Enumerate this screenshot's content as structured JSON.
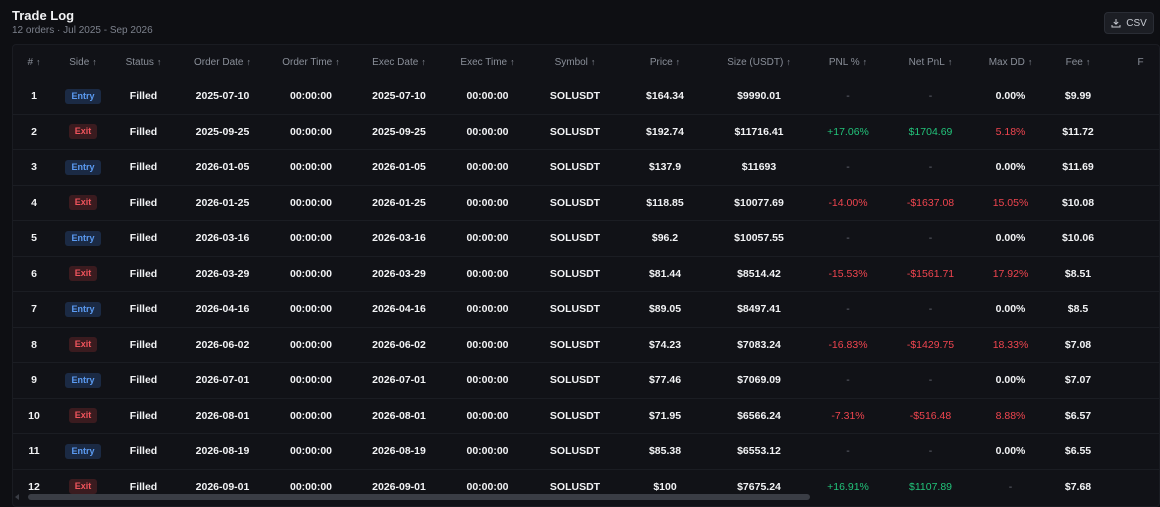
{
  "header": {
    "title": "Trade Log",
    "subtitle": "12 orders · Jul 2025 - Sep 2026",
    "csv_label": "CSV"
  },
  "columns": [
    "#",
    "Side",
    "Status",
    "Order Date",
    "Order Time",
    "Exec Date",
    "Exec Time",
    "Symbol",
    "Price",
    "Size (USDT)",
    "PNL %",
    "Net PnL",
    "Max DD",
    "Fee",
    "F"
  ],
  "colors": {
    "entry": "#5b9bf2",
    "exit": "#f0545c",
    "positive": "#22c37a",
    "negative": "#f0454f"
  },
  "rows": [
    {
      "n": "1",
      "side": "Entry",
      "status": "Filled",
      "order_date": "2025-07-10",
      "order_time": "00:00:00",
      "exec_date": "2025-07-10",
      "exec_time": "00:00:00",
      "symbol": "SOLUSDT",
      "price": "$164.34",
      "size": "$9990.01",
      "pnl_pct": "-",
      "net_pnl": "-",
      "max_dd": "0.00%",
      "fee": "$9.99"
    },
    {
      "n": "2",
      "side": "Exit",
      "status": "Filled",
      "order_date": "2025-09-25",
      "order_time": "00:00:00",
      "exec_date": "2025-09-25",
      "exec_time": "00:00:00",
      "symbol": "SOLUSDT",
      "price": "$192.74",
      "size": "$11716.41",
      "pnl_pct": "+17.06%",
      "net_pnl": "$1704.69",
      "max_dd": "5.18%",
      "fee": "$11.72"
    },
    {
      "n": "3",
      "side": "Entry",
      "status": "Filled",
      "order_date": "2026-01-05",
      "order_time": "00:00:00",
      "exec_date": "2026-01-05",
      "exec_time": "00:00:00",
      "symbol": "SOLUSDT",
      "price": "$137.9",
      "size": "$11693",
      "pnl_pct": "-",
      "net_pnl": "-",
      "max_dd": "0.00%",
      "fee": "$11.69"
    },
    {
      "n": "4",
      "side": "Exit",
      "status": "Filled",
      "order_date": "2026-01-25",
      "order_time": "00:00:00",
      "exec_date": "2026-01-25",
      "exec_time": "00:00:00",
      "symbol": "SOLUSDT",
      "price": "$118.85",
      "size": "$10077.69",
      "pnl_pct": "-14.00%",
      "net_pnl": "-$1637.08",
      "max_dd": "15.05%",
      "fee": "$10.08"
    },
    {
      "n": "5",
      "side": "Entry",
      "status": "Filled",
      "order_date": "2026-03-16",
      "order_time": "00:00:00",
      "exec_date": "2026-03-16",
      "exec_time": "00:00:00",
      "symbol": "SOLUSDT",
      "price": "$96.2",
      "size": "$10057.55",
      "pnl_pct": "-",
      "net_pnl": "-",
      "max_dd": "0.00%",
      "fee": "$10.06"
    },
    {
      "n": "6",
      "side": "Exit",
      "status": "Filled",
      "order_date": "2026-03-29",
      "order_time": "00:00:00",
      "exec_date": "2026-03-29",
      "exec_time": "00:00:00",
      "symbol": "SOLUSDT",
      "price": "$81.44",
      "size": "$8514.42",
      "pnl_pct": "-15.53%",
      "net_pnl": "-$1561.71",
      "max_dd": "17.92%",
      "fee": "$8.51"
    },
    {
      "n": "7",
      "side": "Entry",
      "status": "Filled",
      "order_date": "2026-04-16",
      "order_time": "00:00:00",
      "exec_date": "2026-04-16",
      "exec_time": "00:00:00",
      "symbol": "SOLUSDT",
      "price": "$89.05",
      "size": "$8497.41",
      "pnl_pct": "-",
      "net_pnl": "-",
      "max_dd": "0.00%",
      "fee": "$8.5"
    },
    {
      "n": "8",
      "side": "Exit",
      "status": "Filled",
      "order_date": "2026-06-02",
      "order_time": "00:00:00",
      "exec_date": "2026-06-02",
      "exec_time": "00:00:00",
      "symbol": "SOLUSDT",
      "price": "$74.23",
      "size": "$7083.24",
      "pnl_pct": "-16.83%",
      "net_pnl": "-$1429.75",
      "max_dd": "18.33%",
      "fee": "$7.08"
    },
    {
      "n": "9",
      "side": "Entry",
      "status": "Filled",
      "order_date": "2026-07-01",
      "order_time": "00:00:00",
      "exec_date": "2026-07-01",
      "exec_time": "00:00:00",
      "symbol": "SOLUSDT",
      "price": "$77.46",
      "size": "$7069.09",
      "pnl_pct": "-",
      "net_pnl": "-",
      "max_dd": "0.00%",
      "fee": "$7.07"
    },
    {
      "n": "10",
      "side": "Exit",
      "status": "Filled",
      "order_date": "2026-08-01",
      "order_time": "00:00:00",
      "exec_date": "2026-08-01",
      "exec_time": "00:00:00",
      "symbol": "SOLUSDT",
      "price": "$71.95",
      "size": "$6566.24",
      "pnl_pct": "-7.31%",
      "net_pnl": "-$516.48",
      "max_dd": "8.88%",
      "fee": "$6.57"
    },
    {
      "n": "11",
      "side": "Entry",
      "status": "Filled",
      "order_date": "2026-08-19",
      "order_time": "00:00:00",
      "exec_date": "2026-08-19",
      "exec_time": "00:00:00",
      "symbol": "SOLUSDT",
      "price": "$85.38",
      "size": "$6553.12",
      "pnl_pct": "-",
      "net_pnl": "-",
      "max_dd": "0.00%",
      "fee": "$6.55"
    },
    {
      "n": "12",
      "side": "Exit",
      "status": "Filled",
      "order_date": "2026-09-01",
      "order_time": "00:00:00",
      "exec_date": "2026-09-01",
      "exec_time": "00:00:00",
      "symbol": "SOLUSDT",
      "price": "$100",
      "size": "$7675.24",
      "pnl_pct": "+16.91%",
      "net_pnl": "$1107.89",
      "max_dd": "-",
      "fee": "$7.68"
    }
  ]
}
